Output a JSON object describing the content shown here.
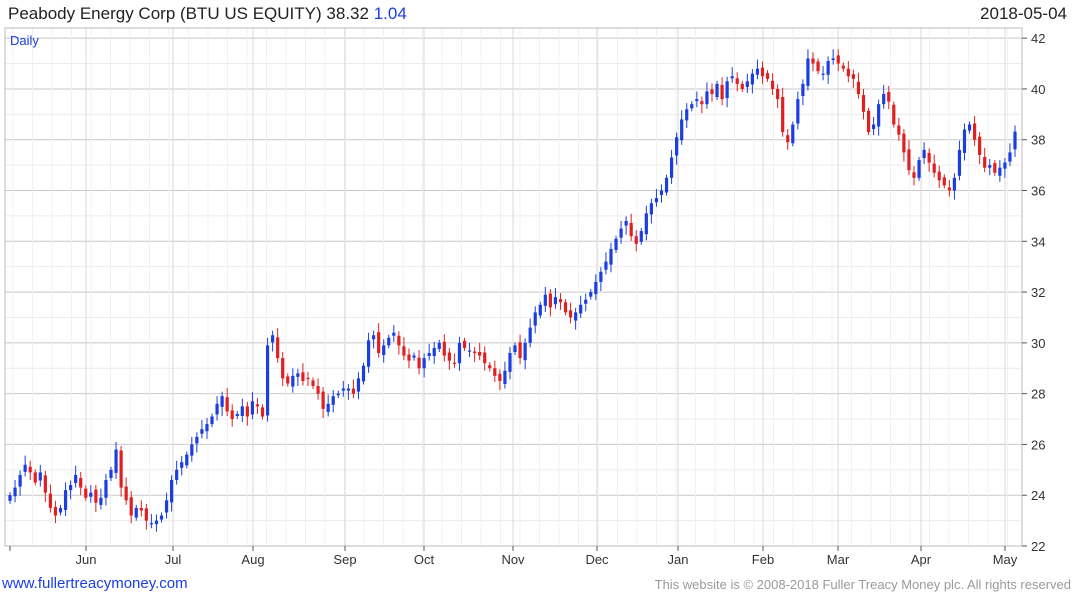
{
  "header": {
    "title": "Peabody Energy Corp (BTU US EQUITY)",
    "last": "38.32",
    "change": "1.04",
    "date": "2018-05-04"
  },
  "footer": {
    "site": "www.fullertreacymoney.com",
    "copyright": "This website is © 2008-2018 Fuller Treacy Money plc. All rights reserved"
  },
  "colors": {
    "up": "#1a3ee0",
    "down": "#e02020",
    "grid": "#d4d4d4"
  },
  "chart_data": {
    "type": "candlestick",
    "frequency": "Daily",
    "ylim": [
      22,
      42.4
    ],
    "yticks": [
      22,
      24,
      26,
      28,
      30,
      32,
      34,
      36,
      38,
      40,
      42
    ],
    "months": [
      "Jun",
      "Jul",
      "Aug",
      "Sep",
      "Oct",
      "Nov",
      "Dec",
      "Jan",
      "Feb",
      "Mar",
      "Apr",
      "May"
    ],
    "close_series": [
      24.0,
      24.3,
      24.8,
      25.2,
      24.9,
      24.5,
      24.9,
      24.1,
      23.5,
      23.2,
      23.5,
      24.2,
      24.4,
      24.8,
      24.3,
      23.9,
      24.1,
      23.7,
      23.9,
      24.6,
      25.0,
      25.8,
      24.3,
      23.8,
      23.2,
      23.5,
      23.4,
      23.0,
      22.9,
      23.0,
      23.2,
      23.8,
      24.6,
      25.0,
      25.3,
      25.6,
      26.0,
      26.3,
      26.6,
      26.8,
      27.1,
      27.6,
      27.9,
      27.3,
      27.0,
      27.2,
      27.5,
      27.1,
      27.7,
      27.5,
      27.1,
      29.9,
      30.3,
      29.4,
      28.6,
      28.4,
      28.7,
      28.8,
      28.5,
      28.6,
      28.3,
      28.0,
      27.4,
      27.6,
      27.9,
      28.0,
      28.2,
      28.2,
      28.0,
      28.6,
      29.1,
      30.1,
      30.3,
      29.6,
      29.9,
      30.2,
      30.4,
      29.9,
      29.5,
      29.3,
      29.5,
      29.0,
      29.4,
      29.6,
      29.8,
      30.0,
      29.5,
      29.3,
      29.2,
      30.0,
      29.8,
      29.7,
      29.6,
      29.5,
      29.2,
      29.0,
      28.7,
      28.5,
      28.9,
      29.6,
      29.9,
      29.4,
      30.0,
      30.6,
      31.2,
      31.5,
      31.9,
      31.4,
      31.8,
      31.6,
      31.2,
      31.0,
      31.2,
      31.5,
      31.7,
      32.0,
      32.4,
      32.8,
      33.2,
      33.7,
      34.1,
      34.5,
      34.8,
      34.2,
      33.9,
      34.4,
      35.1,
      35.5,
      35.7,
      36.0,
      36.5,
      37.3,
      38.1,
      38.8,
      39.2,
      39.4,
      39.6,
      39.4,
      39.9,
      39.8,
      40.2,
      39.6,
      40.3,
      40.5,
      40.2,
      40.0,
      40.3,
      40.6,
      40.8,
      40.5,
      40.4,
      40.0,
      39.6,
      38.3,
      37.9,
      38.6,
      39.6,
      40.2,
      41.2,
      41.0,
      40.7,
      40.6,
      41.1,
      41.2,
      41.0,
      40.8,
      40.5,
      40.4,
      39.8,
      39.1,
      38.3,
      38.6,
      39.4,
      39.8,
      39.5,
      38.6,
      38.2,
      37.5,
      36.8,
      36.5,
      37.2,
      37.6,
      37.1,
      36.7,
      36.4,
      36.2,
      36.0,
      36.5,
      37.6,
      38.4,
      38.6,
      38.0,
      37.4,
      36.9,
      37.0,
      36.7,
      36.9,
      37.1,
      37.5,
      38.32
    ]
  }
}
